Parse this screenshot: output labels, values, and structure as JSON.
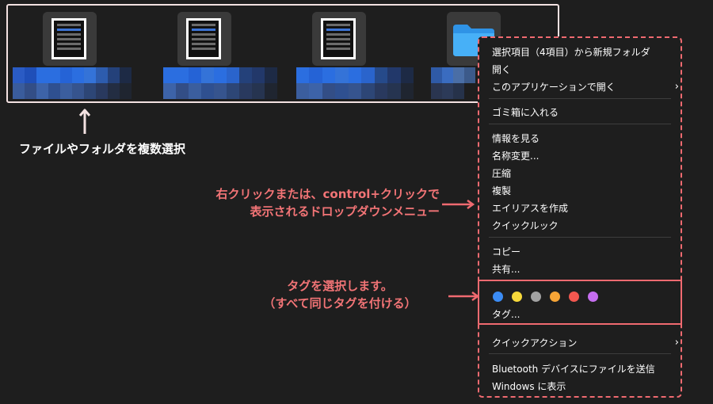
{
  "annotations": {
    "multi_select": "ファイルやフォルダを複数選択",
    "right_click_line1": "右クリックまたは、control+クリックで",
    "right_click_line2": "表示されるドロップダウンメニュー",
    "tag_line1": "タグを選択します。",
    "tag_line2": "（すべて同じタグを付ける）"
  },
  "menu": {
    "new_folder": "選択項目（4項目）から新規フォルダ",
    "open": "開く",
    "open_with": "このアプリケーションで開く",
    "trash": "ゴミ箱に入れる",
    "get_info": "情報を見る",
    "rename": "名称変更...",
    "compress": "圧縮",
    "duplicate": "複製",
    "make_alias": "エイリアスを作成",
    "quick_look": "クイックルック",
    "copy": "コピー",
    "share": "共有...",
    "tags": "タグ...",
    "quick_actions": "クイックアクション",
    "bluetooth": "Bluetooth デバイスにファイルを送信",
    "windows": "Windows に表示"
  },
  "tag_colors": [
    {
      "name": "blue",
      "hex": "#3b8cf5"
    },
    {
      "name": "yellow",
      "hex": "#f7d93b"
    },
    {
      "name": "gray",
      "hex": "#a2a2a2"
    },
    {
      "name": "orange",
      "hex": "#f6a436"
    },
    {
      "name": "red",
      "hex": "#f2574f"
    },
    {
      "name": "purple",
      "hex": "#c66ef0"
    }
  ],
  "colors": {
    "accent": "#f06a70",
    "frame": "#f3e1e1",
    "selection_blue": "#2b6ee0",
    "folder_blue": "#3fa8f5"
  },
  "icons": {
    "chevron": "chevron-right-icon",
    "folder": "folder-icon",
    "document": "document-thumbnail-icon"
  }
}
